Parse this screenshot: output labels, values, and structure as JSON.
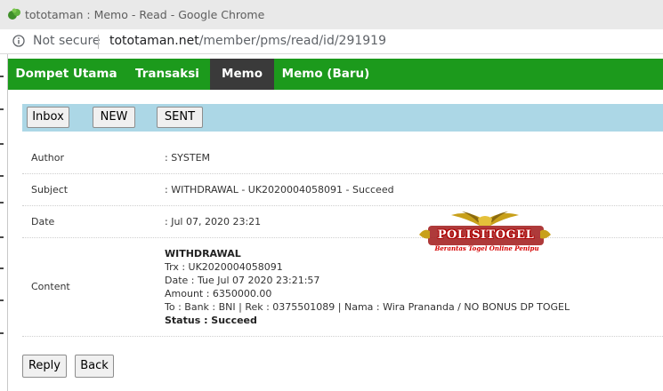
{
  "browser": {
    "window_title": "tototaman : Memo - Read - Google Chrome",
    "security_label": "Not secure",
    "url_domain": "tototaman.net",
    "url_path": "/member/pms/read/id/291919"
  },
  "nav": {
    "tabs": [
      {
        "label": "Dompet Utama",
        "active": false
      },
      {
        "label": "Transaksi",
        "active": false
      },
      {
        "label": "Memo",
        "active": true
      },
      {
        "label": "Memo (Baru)",
        "active": false
      }
    ]
  },
  "toolbar": {
    "inbox_label": "Inbox",
    "new_label": "NEW",
    "sent_label": "SENT"
  },
  "memo": {
    "author_label": "Author",
    "author_value": ": SYSTEM",
    "subject_label": "Subject",
    "subject_value": ": WITHDRAWAL - UK2020004058091 - Succeed",
    "date_label": "Date",
    "date_value": ": Jul 07, 2020 23:21",
    "content_label": "Content",
    "content_lines": [
      "WITHDRAWAL",
      "Trx : UK2020004058091",
      "Date : Tue Jul 07 2020 23:21:57",
      "Amount : 6350000.00",
      "To : Bank : BNI | Rek : 0375501089 | Nama : Wira Prananda / NO BONUS DP TOGEL",
      "Status : Succeed"
    ]
  },
  "watermark": {
    "name": "POLISITOGEL",
    "tagline": "Berantas Togel Online Penipu"
  },
  "actions": {
    "reply_label": "Reply",
    "back_label": "Back"
  },
  "colors": {
    "nav_bg": "#1c9a1c",
    "nav_active": "#3a3a3a",
    "toolbar_bg": "#acd7e6"
  }
}
